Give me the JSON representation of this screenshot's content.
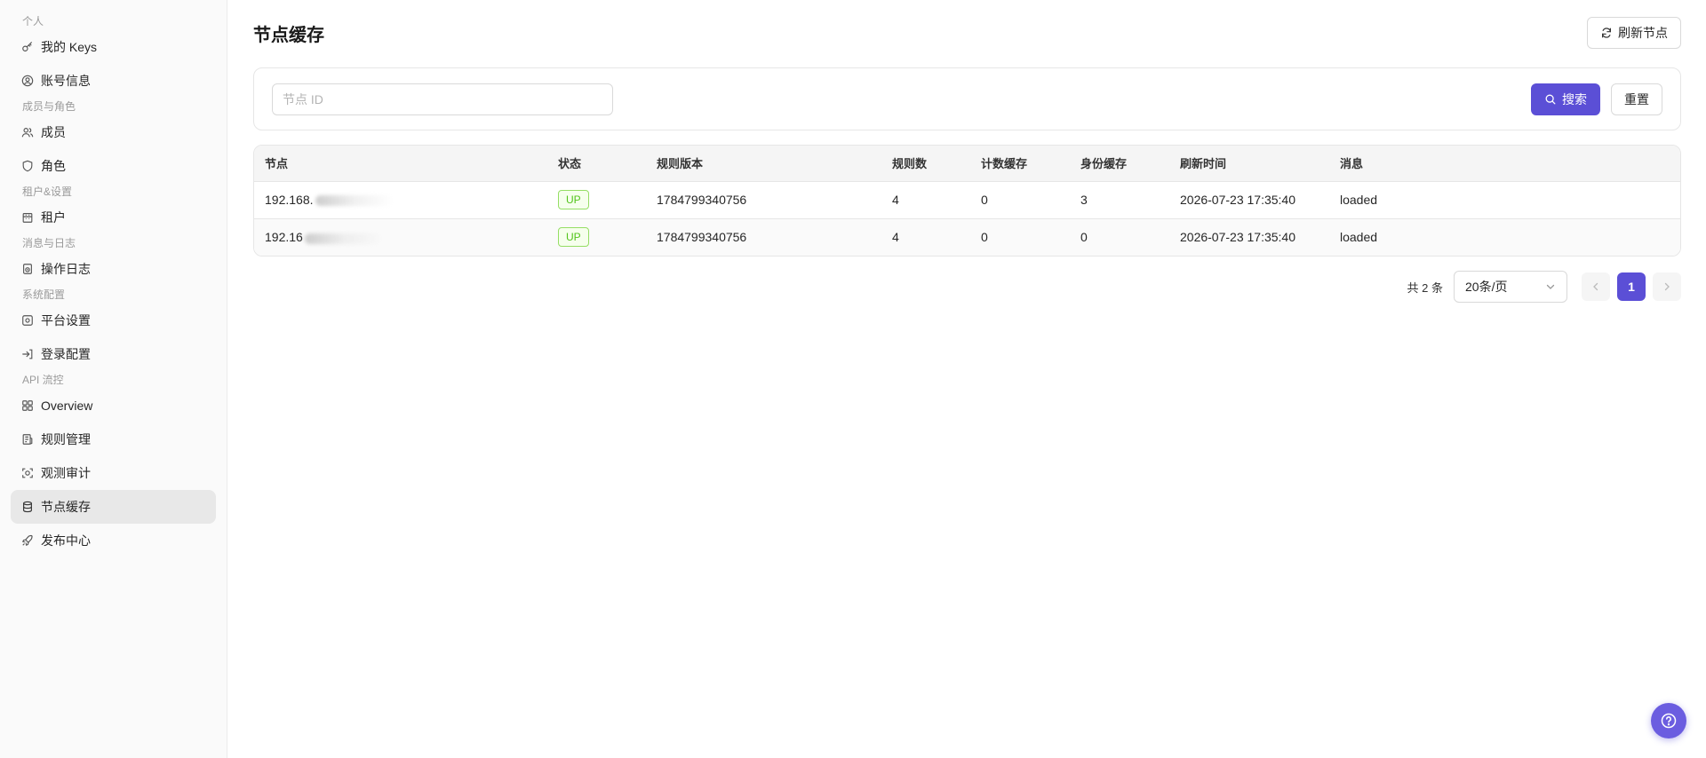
{
  "sidebar": {
    "groups": [
      {
        "label": "个人",
        "items": [
          {
            "label": "我的 Keys",
            "icon": "key-icon"
          },
          {
            "label": "账号信息",
            "icon": "user-circle-icon"
          }
        ]
      },
      {
        "label": "成员与角色",
        "items": [
          {
            "label": "成员",
            "icon": "users-icon"
          },
          {
            "label": "角色",
            "icon": "shield-icon"
          }
        ]
      },
      {
        "label": "租户&设置",
        "items": [
          {
            "label": "租户",
            "icon": "building-icon"
          }
        ]
      },
      {
        "label": "消息与日志",
        "items": [
          {
            "label": "操作日志",
            "icon": "log-icon"
          }
        ]
      },
      {
        "label": "系统配置",
        "items": [
          {
            "label": "平台设置",
            "icon": "settings-icon"
          },
          {
            "label": "登录配置",
            "icon": "login-icon"
          }
        ]
      },
      {
        "label": "API 流控",
        "items": [
          {
            "label": "Overview",
            "icon": "grid-icon"
          },
          {
            "label": "规则管理",
            "icon": "rules-icon"
          },
          {
            "label": "观测审计",
            "icon": "scan-icon"
          },
          {
            "label": "节点缓存",
            "icon": "database-icon",
            "active": true
          },
          {
            "label": "发布中心",
            "icon": "rocket-icon"
          }
        ]
      }
    ]
  },
  "header": {
    "title": "节点缓存",
    "refresh_label": "刷新节点"
  },
  "search": {
    "placeholder": "节点 ID",
    "search_label": "搜索",
    "reset_label": "重置"
  },
  "table": {
    "columns": [
      "节点",
      "状态",
      "规则版本",
      "规则数",
      "计数缓存",
      "身份缓存",
      "刷新时间",
      "消息"
    ],
    "rows": [
      {
        "node": "192.168.",
        "status": "UP",
        "rule_version": "1784799340756",
        "rule_count": "4",
        "count_cache": "0",
        "identity_cache": "3",
        "refresh_time": "2026-07-23 17:35:40",
        "message": "loaded"
      },
      {
        "node": "192.16",
        "status": "UP",
        "rule_version": "1784799340756",
        "rule_count": "4",
        "count_cache": "0",
        "identity_cache": "0",
        "refresh_time": "2026-07-23 17:35:40",
        "message": "loaded"
      }
    ]
  },
  "pagination": {
    "total_label": "共 2 条",
    "page_size": "20条/页",
    "current_page": "1"
  },
  "colors": {
    "primary": "#5b4fd6",
    "up_tag": "#52c41a",
    "active_nav": "#e8e8e8"
  }
}
